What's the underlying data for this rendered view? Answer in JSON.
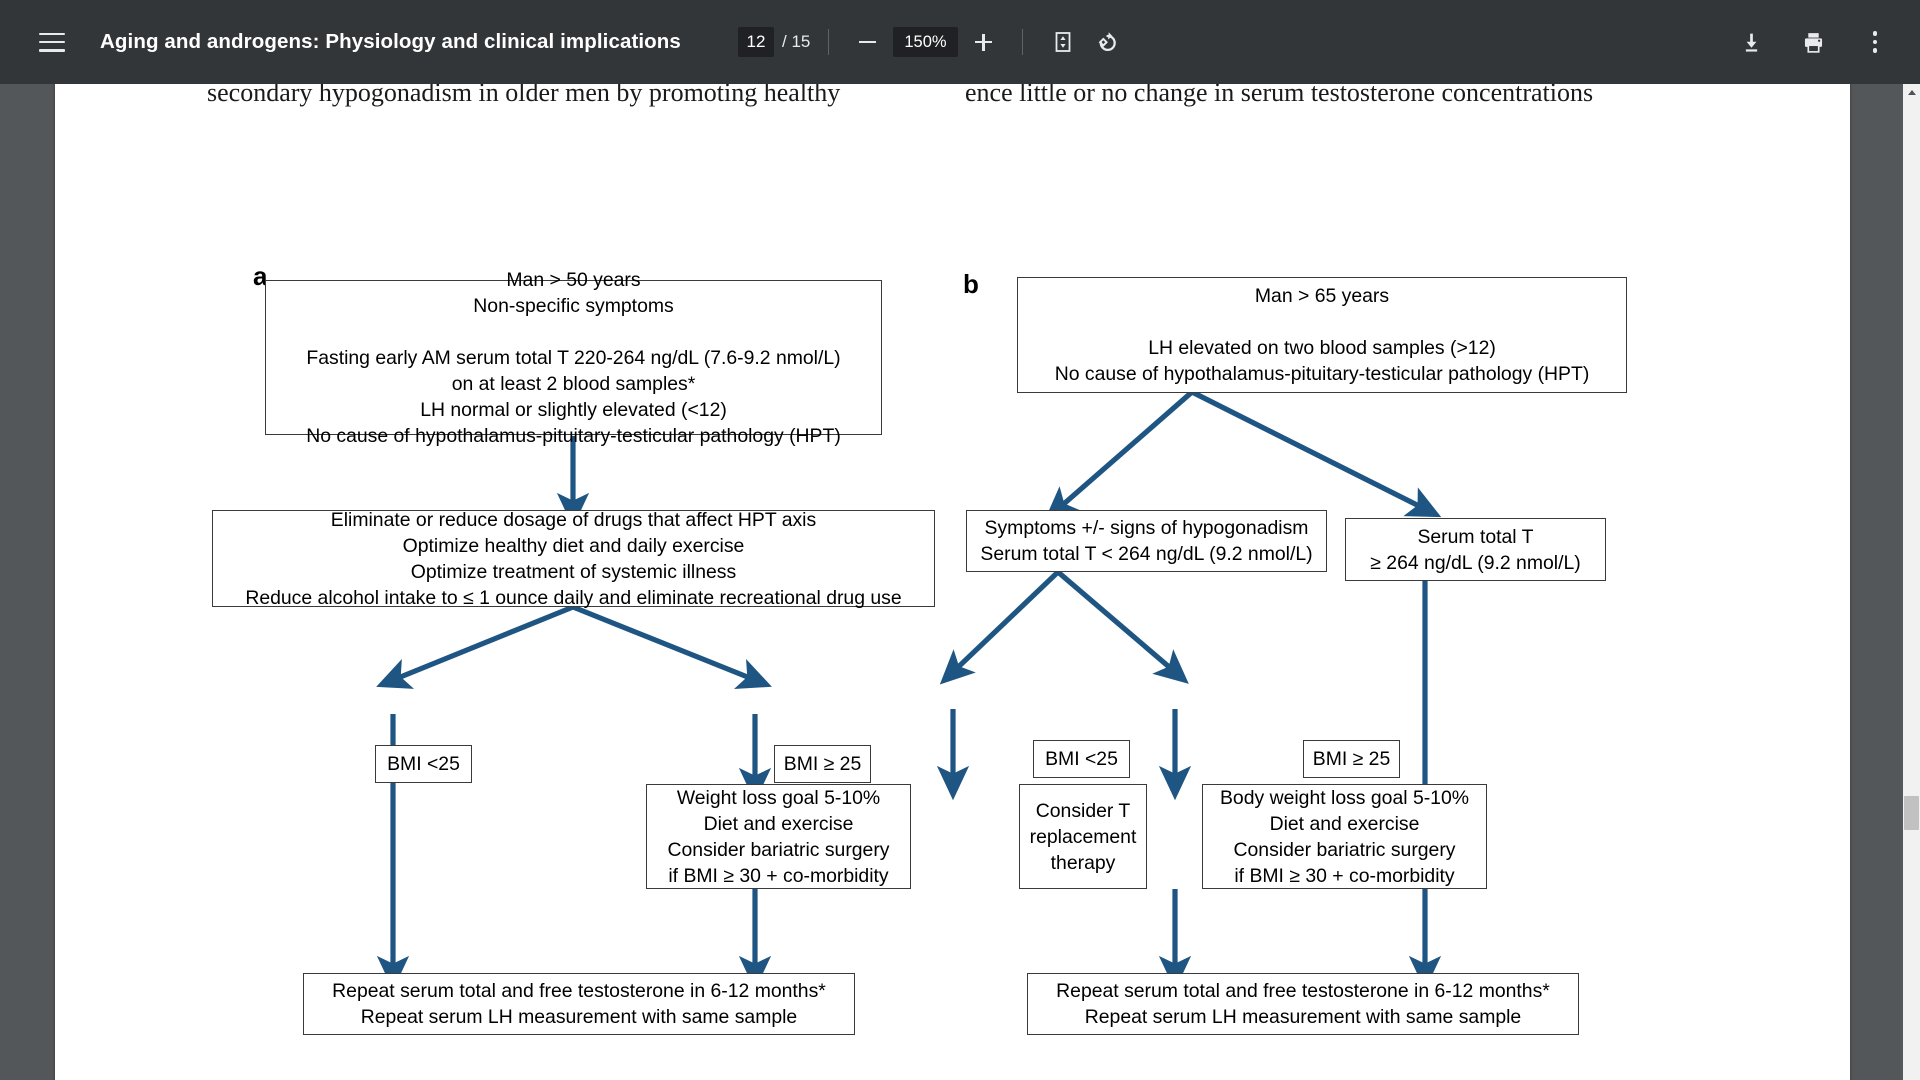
{
  "toolbar": {
    "menu_icon": "hamburger-menu-icon",
    "document_title": "Aging and androgens: Physiology and clinical implications",
    "page_number": "12",
    "page_total": "/ 15",
    "zoom_out_icon": "minus-icon",
    "zoom_level": "150%",
    "zoom_in_icon": "plus-icon",
    "fit_page_icon": "fit-to-page-icon",
    "rotate_icon": "rotate-counterclockwise-icon",
    "download_icon": "download-icon",
    "print_icon": "print-icon",
    "more_icon": "more-options-icon",
    "background_color": "#323639"
  },
  "document": {
    "running_text_left": "secondary hypogonadism in older men by promoting healthy",
    "running_text_right": "ence little or no change in serum testosterone concentrations",
    "page_background": "#ffffff",
    "viewer_background": "#545759"
  },
  "figure": {
    "arrow_color": "#1f5582",
    "box_border_color": "#3a3a3a",
    "panels": [
      {
        "label": "a",
        "nodes": [
          {
            "id": "a-entry",
            "text": "Man > 50 years\nNon-specific symptoms\n\nFasting early AM serum total T 220-264 ng/dL (7.6-9.2 nmol/L)\non at least 2 blood samples*\nLH normal or slightly elevated (<12)\nNo cause of hypothalamus-pituitary-testicular pathology (HPT)"
          },
          {
            "id": "a-lifestyle",
            "text": "Eliminate or reduce dosage of drugs that affect HPT axis\nOptimize healthy diet and daily exercise\nOptimize treatment of systemic illness\nReduce alcohol intake to ≤ 1 ounce daily and eliminate recreational drug use"
          },
          {
            "id": "a-bmi-low",
            "text": "BMI <25"
          },
          {
            "id": "a-bmi-high",
            "text": "BMI ≥ 25"
          },
          {
            "id": "a-weightloss",
            "text": "Weight loss goal 5-10%\nDiet and exercise\nConsider bariatric surgery\nif BMI ≥ 30 + co-morbidity"
          },
          {
            "id": "a-repeat",
            "text": "Repeat serum total and free testosterone in 6-12 months*\nRepeat serum LH measurement with same sample"
          }
        ]
      },
      {
        "label": "b",
        "nodes": [
          {
            "id": "b-entry",
            "text": "Man > 65 years\n\nLH elevated on two blood samples (>12)\nNo cause of hypothalamus-pituitary-testicular pathology (HPT)"
          },
          {
            "id": "b-symptomatic",
            "text": "Symptoms +/- signs of hypogonadism\nSerum total T < 264 ng/dL (9.2 nmol/L)"
          },
          {
            "id": "b-normal-t",
            "text": "Serum total T\n≥ 264 ng/dL (9.2 nmol/L)"
          },
          {
            "id": "b-bmi-low",
            "text": "BMI <25"
          },
          {
            "id": "b-bmi-high",
            "text": "BMI ≥ 25"
          },
          {
            "id": "b-consider-t",
            "text": "Consider T\nreplacement\ntherapy"
          },
          {
            "id": "b-weightloss",
            "text": "Body weight loss goal 5-10%\nDiet and exercise\nConsider bariatric surgery\nif BMI ≥ 30 + co-morbidity"
          },
          {
            "id": "b-repeat",
            "text": "Repeat serum total and free testosterone in 6-12 months*\nRepeat serum LH measurement with same sample"
          }
        ]
      }
    ]
  },
  "scrollbar": {
    "up_arrow_icon": "scroll-up-arrow-icon",
    "thumb_color": "#c1c1c1"
  }
}
